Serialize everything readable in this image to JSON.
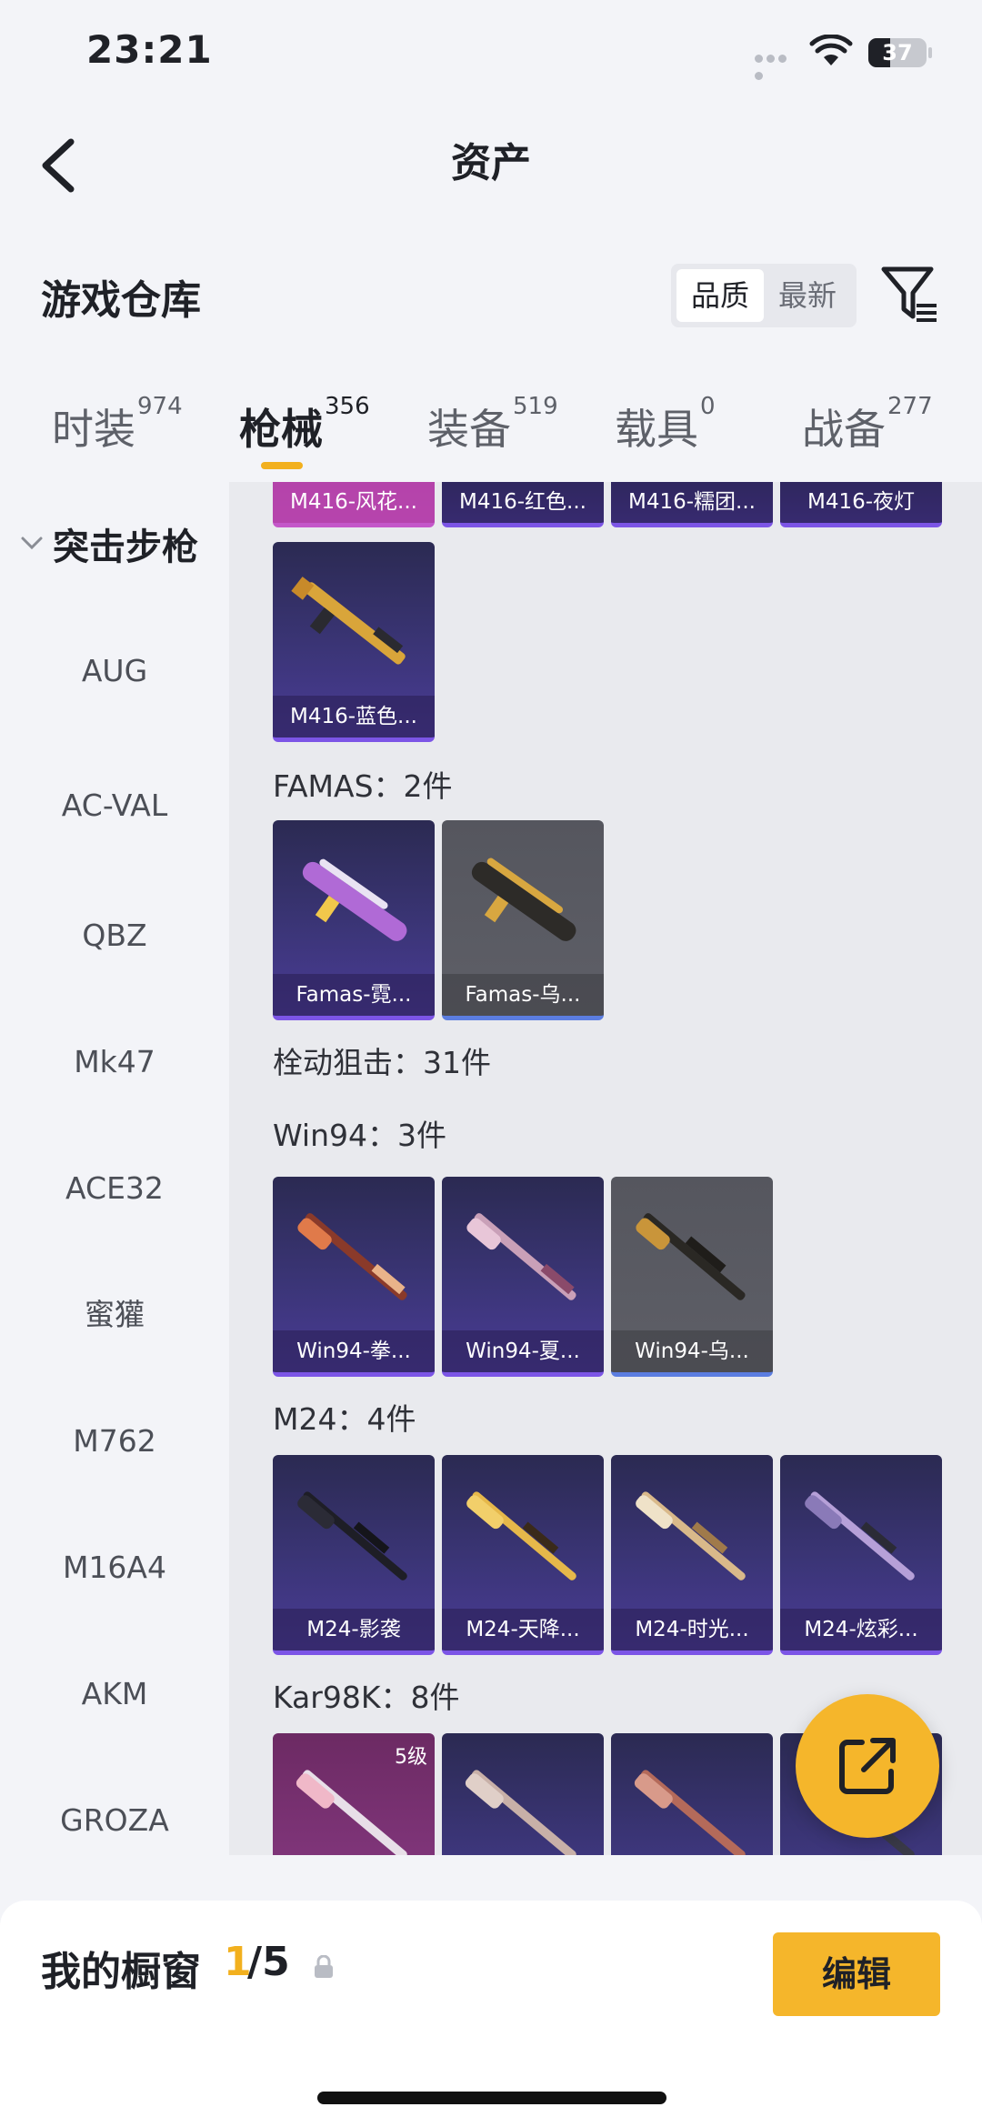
{
  "status": {
    "time": "23:21",
    "battery": "37",
    "battery_level": 0.37
  },
  "nav": {
    "title": "资产",
    "back_icon": "chevron-left-icon"
  },
  "warehouse": {
    "label": "游戏仓库",
    "sort_options": [
      "品质",
      "最新"
    ],
    "sort_selected": "品质"
  },
  "tabs": [
    {
      "name": "时装",
      "count": "974"
    },
    {
      "name": "枪械",
      "count": "356"
    },
    {
      "name": "装备",
      "count": "519"
    },
    {
      "name": "载具",
      "count": "0"
    },
    {
      "name": "战备",
      "count": "277"
    }
  ],
  "active_tab": "枪械",
  "sidebar": {
    "category": "突击步枪",
    "items": [
      "AUG",
      "AC-VAL",
      "QBZ",
      "Mk47",
      "ACE32",
      "蜜獾",
      "M762",
      "M16A4",
      "AKM",
      "GROZA"
    ]
  },
  "partial_top_row": [
    "M416-风花...",
    "M416-红色...",
    "M416-糯团...",
    "M416-夜灯"
  ],
  "m416_last": "M416-蓝色...",
  "groups": {
    "famas": {
      "title": "FAMAS：2件",
      "items": [
        "Famas-霓...",
        "Famas-乌..."
      ]
    },
    "sniper": {
      "title": "栓动狙击：31件"
    },
    "win94": {
      "title": "Win94：3件",
      "items": [
        "Win94-拳...",
        "Win94-夏...",
        "Win94-乌..."
      ]
    },
    "m24": {
      "title": "M24：4件",
      "items": [
        "M24-影袭",
        "M24-天降...",
        "M24-时光...",
        "M24-炫彩..."
      ]
    },
    "kar98k": {
      "title": "Kar98K：8件",
      "first_level": "5级"
    }
  },
  "showcase": {
    "label": "我的橱窗",
    "current": "1",
    "total": "/5",
    "edit": "编辑"
  },
  "colors": {
    "accent": "#f2b01e",
    "purple_rarity": "#7c55e6",
    "blue_rarity": "#5b7de0"
  }
}
